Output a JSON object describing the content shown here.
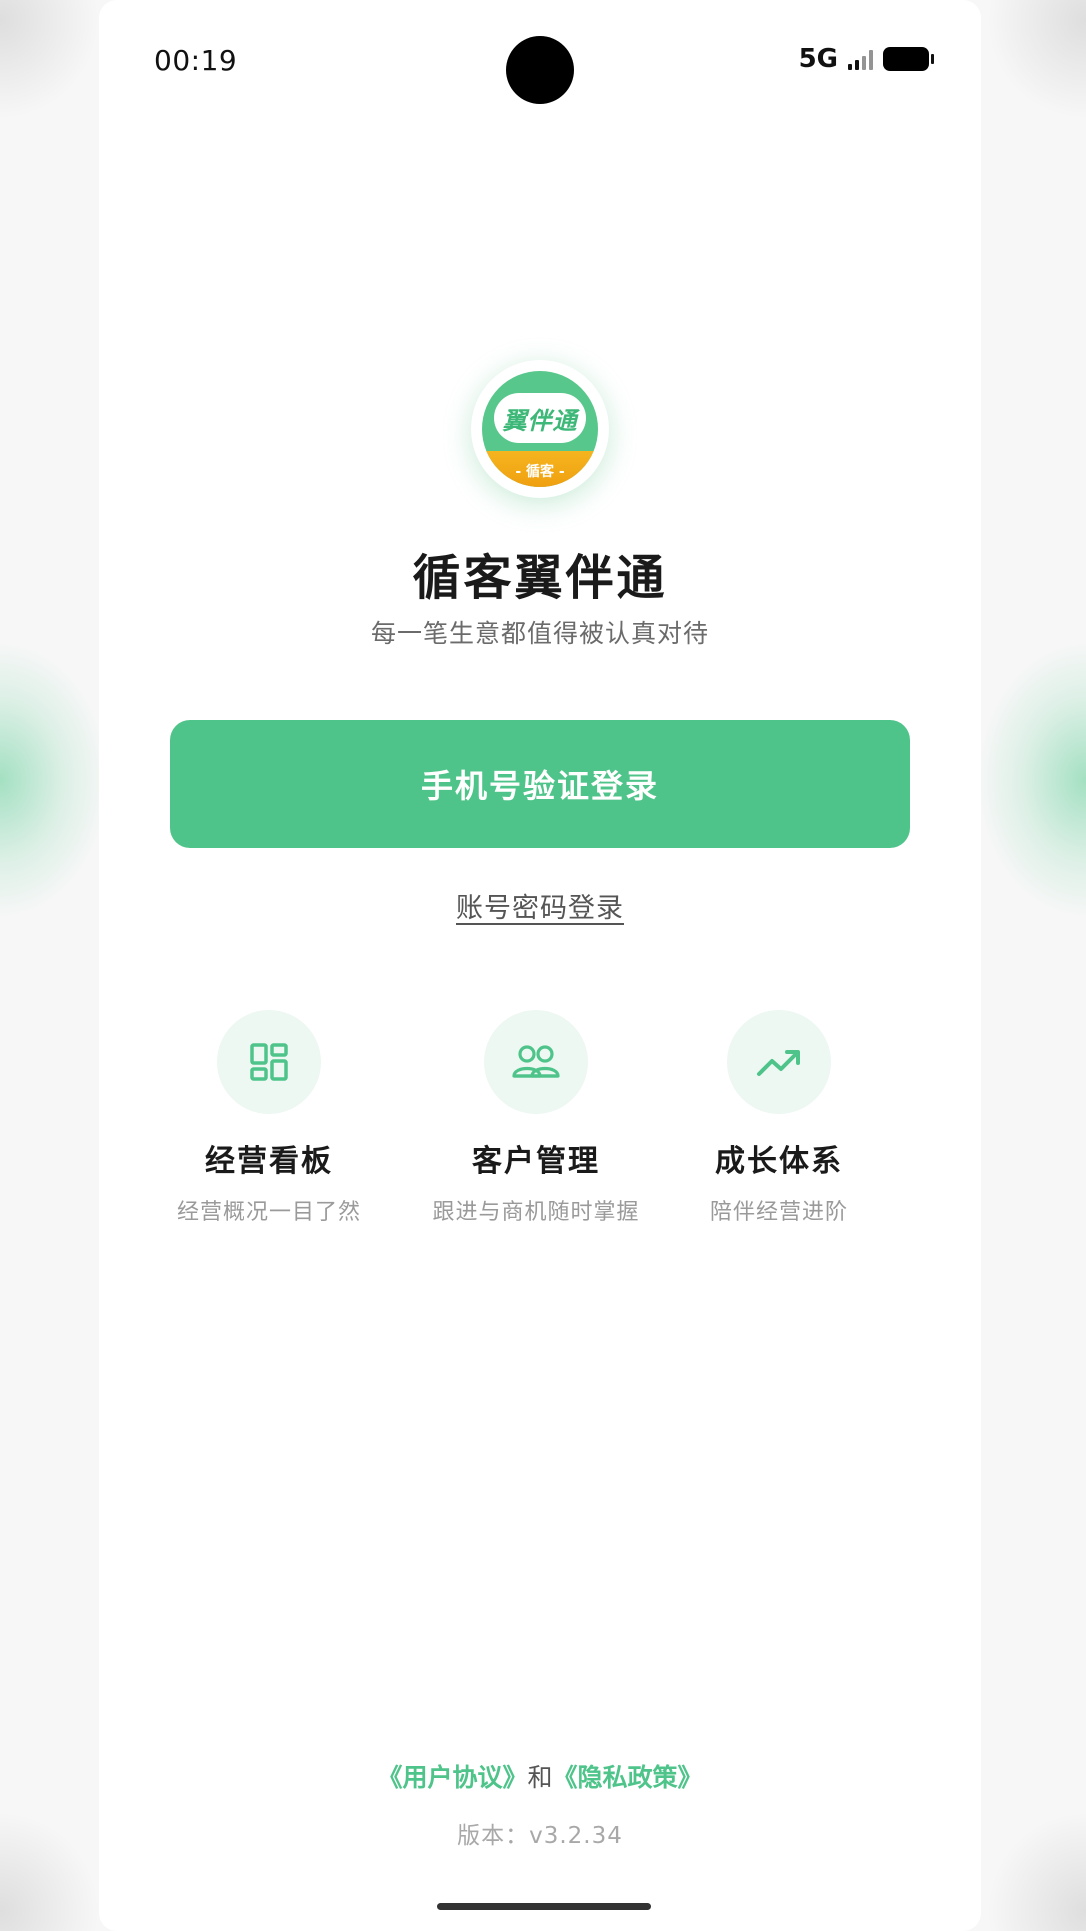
{
  "status_bar": {
    "time": "00:19",
    "network": "5G"
  },
  "app": {
    "logo_text": "翼伴通",
    "logo_subtext": "- 循客 -",
    "title": "循客翼伴通",
    "subtitle": "每一笔生意都值得被认真对待"
  },
  "login": {
    "primary_label": "手机号验证登录",
    "secondary_label": "账号密码登录"
  },
  "features": [
    {
      "icon": "dashboard-icon",
      "title": "经营看板",
      "desc": "经营概况一目了然"
    },
    {
      "icon": "users-icon",
      "title": "客户管理",
      "desc": "跟进与商机随时掌握"
    },
    {
      "icon": "trending-up-icon",
      "title": "成长体系",
      "desc": "陪伴经营进阶"
    }
  ],
  "legal": {
    "user_agreement": "《用户协议》",
    "connector": "和",
    "privacy_policy": "《隐私政策》",
    "version": "版本：v3.2.34"
  },
  "colors": {
    "accent": "#4fc48a",
    "icon_bg": "#edf8f2",
    "logo_band": "#f5b51f"
  }
}
